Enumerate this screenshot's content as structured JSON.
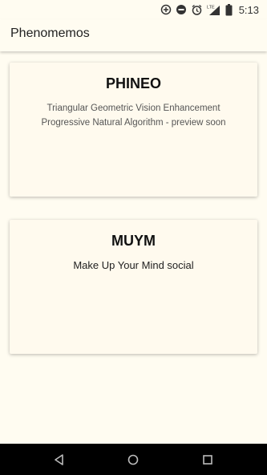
{
  "status_bar": {
    "time": "5:13",
    "icons": [
      "data-saver-icon",
      "do-not-disturb-icon",
      "alarm-icon",
      "lte-signal-icon",
      "battery-icon"
    ],
    "network_label": "LTE"
  },
  "app_bar": {
    "title": "Phenomemos"
  },
  "cards": [
    {
      "title": "PHINEO",
      "description_lines": [
        "Triangular Geometric Vision Enhancement",
        "Progressive Natural Algorithm - preview soon"
      ]
    },
    {
      "title": "MUYM",
      "description": "Make Up Your Mind social"
    }
  ],
  "nav_bar": {
    "icons": [
      "back-icon",
      "home-icon",
      "recents-icon"
    ]
  },
  "colors": {
    "background": "#fffcf1",
    "card": "#fffaee",
    "nav_bar": "#000000"
  }
}
